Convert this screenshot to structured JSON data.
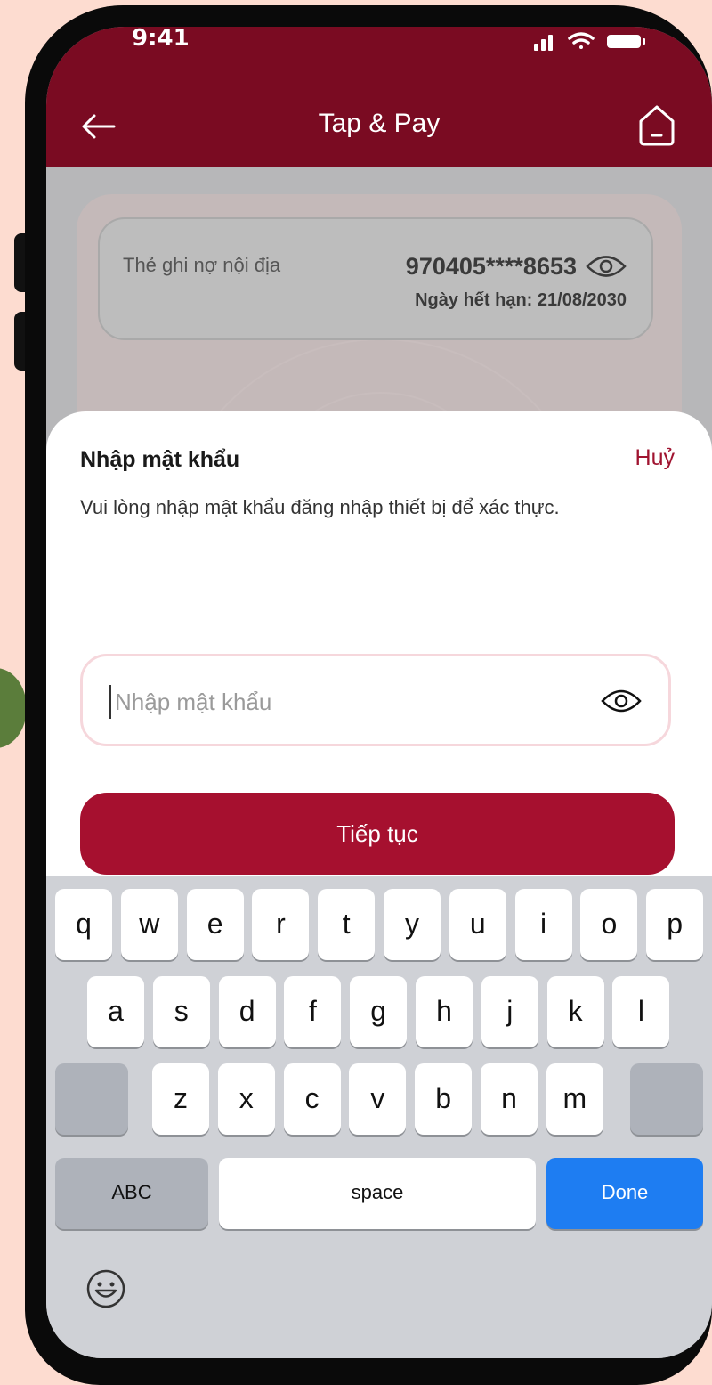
{
  "status_bar": {
    "time": "9:41"
  },
  "header": {
    "title": "Tap & Pay",
    "back_icon": "arrow-left-icon",
    "home_icon": "home-icon",
    "background": "#7a0b22"
  },
  "card": {
    "type": "Thẻ ghi nợ nội địa",
    "number": "970405****8653",
    "expiry": "Ngày hết hạn: 21/08/2030",
    "toggle_icon": "eye-icon"
  },
  "sheet": {
    "title": "Nhập mật khẩu",
    "cancel_label": "Huỷ",
    "description": "Vui lòng nhập mật khẩu đăng nhập thiết bị để xác thực.",
    "password_placeholder": "Nhập mật khẩu",
    "password_value": "",
    "show_password_icon": "eye-icon",
    "continue_label": "Tiếp tục",
    "accent": "#a6102f"
  },
  "keyboard": {
    "row1": [
      "q",
      "w",
      "e",
      "r",
      "t",
      "y",
      "u",
      "i",
      "o",
      "p"
    ],
    "row2": [
      "a",
      "s",
      "d",
      "f",
      "g",
      "h",
      "j",
      "k",
      "l"
    ],
    "row3": [
      "z",
      "x",
      "c",
      "v",
      "b",
      "n",
      "m"
    ],
    "abc_label": "ABC",
    "space_label": "space",
    "done_label": "Done",
    "emoji_icon": "emoji-icon",
    "done_color": "#1e7df2"
  }
}
